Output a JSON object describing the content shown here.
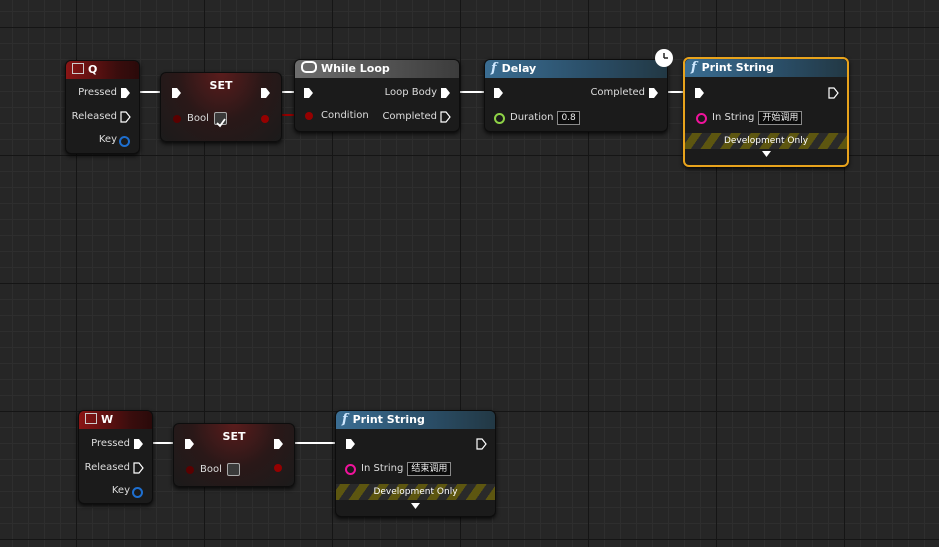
{
  "nodes": {
    "q_event": {
      "title": "Q",
      "pressed": "Pressed",
      "released": "Released",
      "key": "Key"
    },
    "set_true": {
      "title": "SET",
      "var": "Bool",
      "checked": true
    },
    "while_loop": {
      "title": "While Loop",
      "loop_body": "Loop Body",
      "condition": "Condition",
      "completed": "Completed"
    },
    "delay": {
      "title": "Delay",
      "completed": "Completed",
      "duration_label": "Duration",
      "duration_value": "0.8"
    },
    "print_start": {
      "title": "Print String",
      "in_string_label": "In String",
      "in_string_value": "开始调用",
      "dev_only": "Development Only"
    },
    "w_event": {
      "title": "W",
      "pressed": "Pressed",
      "released": "Released",
      "key": "Key"
    },
    "set_false": {
      "title": "SET",
      "var": "Bool",
      "checked": false
    },
    "print_end": {
      "title": "Print String",
      "in_string_label": "In String",
      "in_string_value": "结束调用",
      "dev_only": "Development Only"
    }
  },
  "colors": {
    "exec": "#ffffff",
    "bool_pin": "#950000",
    "string_pin": "#f0139c",
    "float_pin": "#8ed246",
    "struct_pin": "#1e6fcf",
    "selected_border": "#e8a31c"
  },
  "icons": [
    "keyboard-event-icon",
    "while-loop-icon",
    "function-icon",
    "clock-icon",
    "chevron-down-icon"
  ]
}
